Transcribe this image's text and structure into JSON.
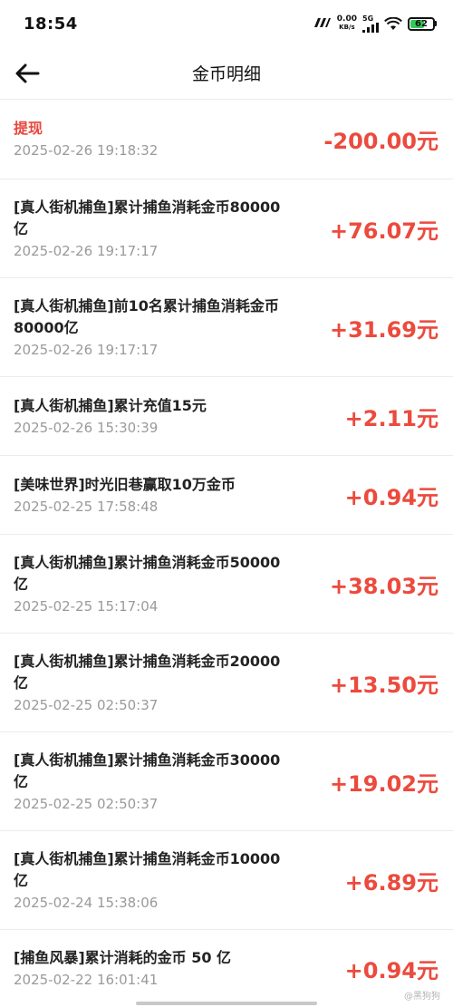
{
  "status": {
    "time": "18:54",
    "carrier_icon": "carrier-logo",
    "net_speed": "0.00",
    "net_unit": "KB/s",
    "signal_label": "5G",
    "battery": "62",
    "battery_level": 0.62,
    "battery_color": "#34c759"
  },
  "header": {
    "title": "金币明细",
    "back_icon": "arrow-left-icon"
  },
  "colors": {
    "amount": "#ec4a3d",
    "title_red": "#e8463c",
    "time_gray": "#9a9a9a"
  },
  "rows": [
    {
      "title": "提现",
      "time": "2025-02-26 19:18:32",
      "amount": "-200.00元",
      "highlight": true
    },
    {
      "title": "[真人街机捕鱼]累计捕鱼消耗金币80000亿",
      "time": "2025-02-26 19:17:17",
      "amount": "+76.07元"
    },
    {
      "title": "[真人街机捕鱼]前10名累计捕鱼消耗金币80000亿",
      "time": "2025-02-26 19:17:17",
      "amount": "+31.69元"
    },
    {
      "title": "[真人街机捕鱼]累计充值15元",
      "time": "2025-02-26 15:30:39",
      "amount": "+2.11元"
    },
    {
      "title": "[美味世界]时光旧巷赢取10万金币",
      "time": "2025-02-25 17:58:48",
      "amount": "+0.94元"
    },
    {
      "title": "[真人街机捕鱼]累计捕鱼消耗金币50000亿",
      "time": "2025-02-25 15:17:04",
      "amount": "+38.03元"
    },
    {
      "title": "[真人街机捕鱼]累计捕鱼消耗金币20000亿",
      "time": "2025-02-25 02:50:37",
      "amount": "+13.50元"
    },
    {
      "title": "[真人街机捕鱼]累计捕鱼消耗金币30000亿",
      "time": "2025-02-25 02:50:37",
      "amount": "+19.02元"
    },
    {
      "title": "[真人街机捕鱼]累计捕鱼消耗金币10000亿",
      "time": "2025-02-24 15:38:06",
      "amount": "+6.89元"
    },
    {
      "title": "[捕鱼风暴]累计消耗的金币 50 亿",
      "time": "2025-02-22 16:01:41",
      "amount": "+0.94元"
    }
  ],
  "watermark": "@黑狗狗"
}
